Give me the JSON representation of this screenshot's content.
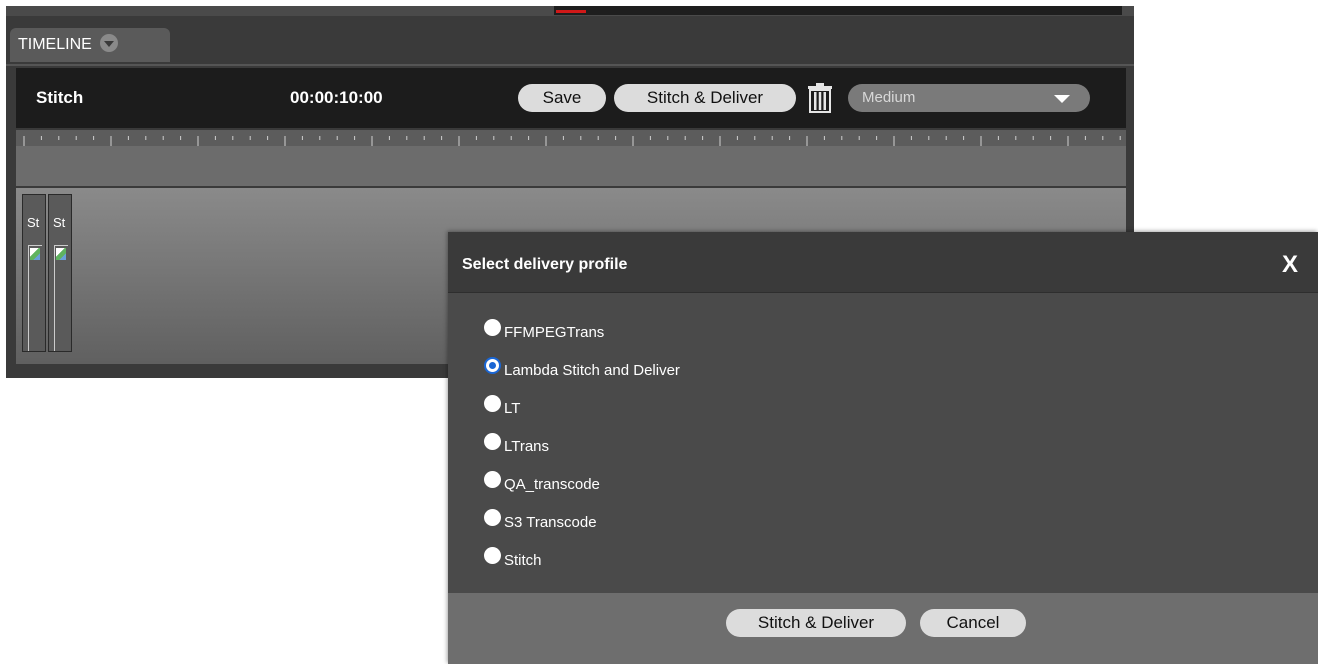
{
  "timeline": {
    "tab_label": "TIMELINE",
    "title": "Stitch",
    "duration": "00:00:10:00",
    "save_label": "Save",
    "stitch_deliver_label": "Stitch & Deliver",
    "quality_value": "Medium",
    "clips": [
      {
        "label": "St"
      },
      {
        "label": "St"
      }
    ]
  },
  "dialog": {
    "title": "Select delivery profile",
    "close_label": "X",
    "options": [
      {
        "label": "FFMPEGTrans",
        "selected": false
      },
      {
        "label": "Lambda Stitch and Deliver",
        "selected": true
      },
      {
        "label": "LT",
        "selected": false
      },
      {
        "label": "LTrans",
        "selected": false
      },
      {
        "label": "QA_transcode",
        "selected": false
      },
      {
        "label": "S3 Transcode",
        "selected": false
      },
      {
        "label": "Stitch",
        "selected": false
      }
    ],
    "submit_label": "Stitch & Deliver",
    "cancel_label": "Cancel"
  },
  "colors": {
    "accent": "#1a66d4",
    "panel": "#3a3a3a",
    "header": "#1c1c1c"
  }
}
